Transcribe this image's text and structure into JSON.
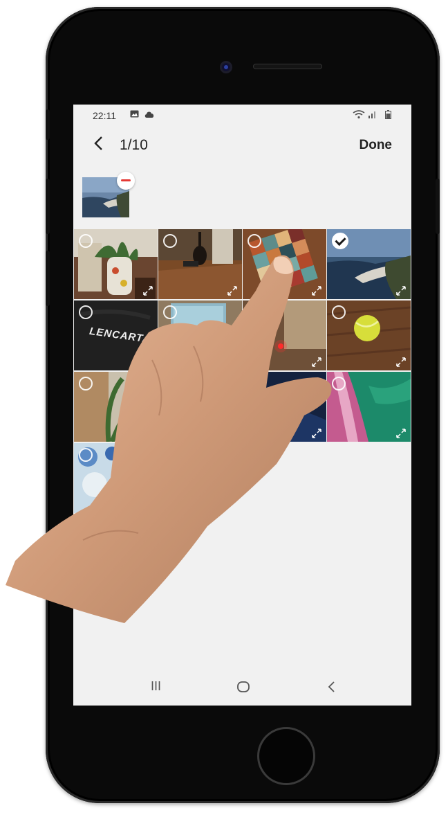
{
  "status_bar": {
    "time": "22:11",
    "left_icons": [
      "image-icon",
      "cloud-icon"
    ],
    "right_icons": [
      "wifi-icon",
      "signal-icon",
      "battery-icon"
    ]
  },
  "header": {
    "back_icon": "back-arrow-icon",
    "counter": "1/10",
    "done_label": "Done"
  },
  "selected_tray": {
    "items": [
      {
        "name": "coastline-photo",
        "remove_icon": "minus-icon"
      }
    ]
  },
  "grid": {
    "photos": [
      {
        "subject": "plant-and-radiator",
        "selected": false,
        "expand_icon": true
      },
      {
        "subject": "guitar-on-wood-floor",
        "selected": false,
        "expand_icon": true
      },
      {
        "subject": "patchwork-quilt",
        "selected": false,
        "expand_icon": true
      },
      {
        "subject": "coastline",
        "selected": true,
        "expand_icon": true
      },
      {
        "subject": "black-t-shirt-lencarta",
        "selected": false,
        "expand_icon": false,
        "caption": "LENCARTA"
      },
      {
        "subject": "blue-painting",
        "selected": false,
        "expand_icon": false
      },
      {
        "subject": "red-laser-dot",
        "selected": false,
        "expand_icon": true
      },
      {
        "subject": "tennis-ball-on-wood",
        "selected": false,
        "expand_icon": true
      },
      {
        "subject": "plant-closeup",
        "selected": false,
        "expand_icon": false
      },
      {
        "subject": "hidden-by-hand-1",
        "selected": false,
        "expand_icon": false
      },
      {
        "subject": "dark-blue-photo",
        "selected": false,
        "expand_icon": true
      },
      {
        "subject": "green-and-pink-aerial",
        "selected": false,
        "expand_icon": true
      },
      {
        "subject": "blue-white-texture",
        "selected": false,
        "expand_icon": false
      }
    ]
  },
  "nav_bar": {
    "recents_glyph": "III",
    "home_glyph": "◯",
    "back_glyph": "<"
  },
  "colors": {
    "screen_bg": "#f1f1f1",
    "remove_badge": "#e53935"
  }
}
